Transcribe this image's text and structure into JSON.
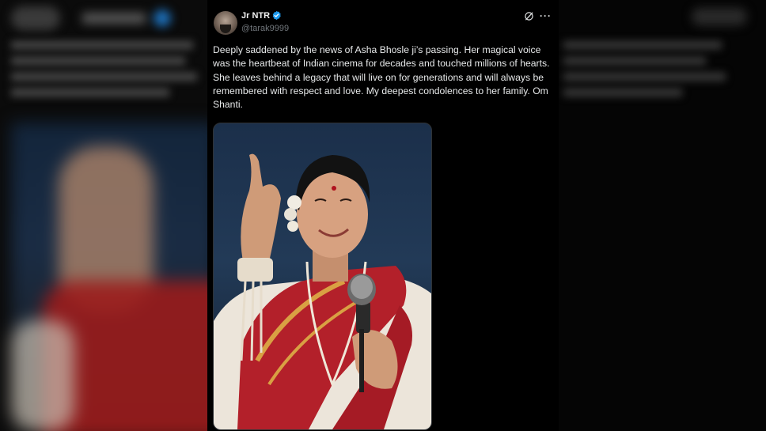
{
  "post": {
    "author_name": "Jr NTR",
    "handle": "@tarak9999",
    "text": "Deeply saddened by the news of Asha Bhosle ji’s passing. Her magical voice was the heartbeat of Indian cinema for decades and touched millions of hearts. She leaves behind a legacy that will live on for generations and will always be remembered with respect and love. My deepest condolences to her family. Om Shanti.",
    "more_label": "···",
    "verified_icon": "verified-badge-icon",
    "colors": {
      "verified": "#1d9bf0",
      "text": "#e7e9ea",
      "handle": "#71767b",
      "background": "#000000"
    }
  }
}
